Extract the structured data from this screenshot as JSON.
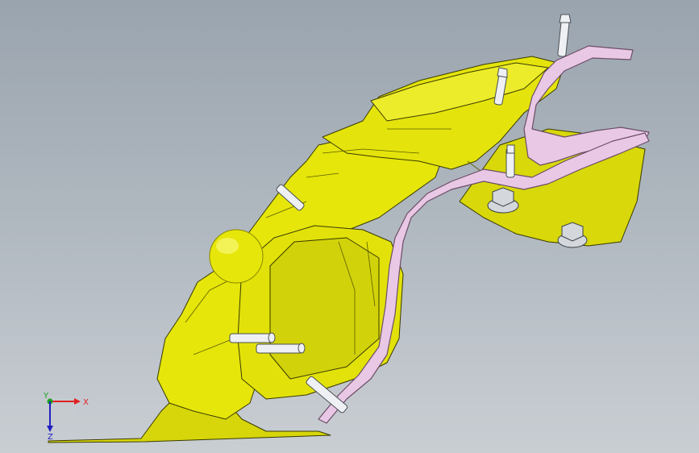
{
  "viewport": {
    "background_top": "#9aa4ae",
    "background_bottom": "#c9ced3"
  },
  "model": {
    "part_color": "#e6e60a",
    "part_shadow": "#b9ba00",
    "edge_color": "#3a3a00",
    "bracket_color": "#e9c8e6",
    "bracket_edge": "#6b4d66",
    "fastener_color": "#eef0f3",
    "nut_color": "#d4d8dc"
  },
  "triad": {
    "x_label": "X",
    "y_label": "Y",
    "z_label": "Z",
    "x_color": "#e02020",
    "y_color": "#1aa01a",
    "z_color": "#2020c0"
  }
}
